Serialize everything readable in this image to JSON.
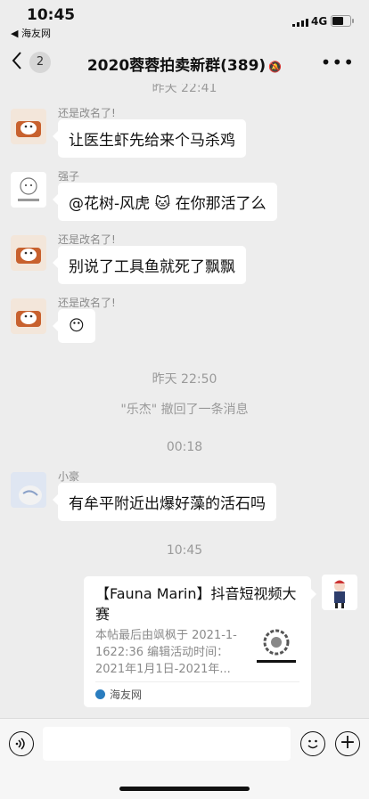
{
  "status": {
    "time": "10:45",
    "back_app": "◀ 海友网",
    "network": "4G"
  },
  "nav": {
    "back_icon": "chevron-left-icon",
    "unread": "2",
    "title": "2020蓉蓉拍卖新群(389)",
    "mute_icon": "bell-off-icon",
    "more_icon": "more-dots-icon"
  },
  "messages": [
    {
      "sender": "还是改名了!",
      "text": "让医生虾先给来个马杀鸡"
    },
    {
      "sender": "强子",
      "text": "@花树-风虎 🐱 在你那活了么"
    },
    {
      "sender": "还是改名了!",
      "text": "别说了工具鱼就死了飘飘"
    },
    {
      "sender": "还是改名了!",
      "text": "😶"
    },
    {
      "sender": "小豪",
      "text": "有牟平附近出爆好藻的活石吗"
    }
  ],
  "system": {
    "time_top": "昨天 22:41",
    "time1": "昨天 22:50",
    "recall": "\"乐杰\" 撤回了一条消息",
    "time2": "00:18",
    "time3": "10:45"
  },
  "card": {
    "title": "【Fauna Marin】抖音短视频大赛",
    "desc": "本帖最后由飒枫于 2021-1-1622:36 编辑活动时间：2021年1月1日-2021年...",
    "source": "海友网"
  },
  "input": {
    "voice_icon": "voice-icon",
    "emoji_icon": "emoji-icon",
    "plus_icon": "plus-icon"
  }
}
